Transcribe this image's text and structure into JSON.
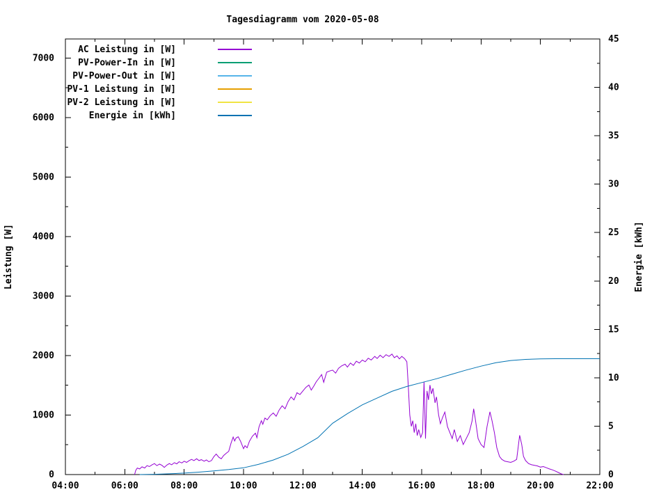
{
  "title": "Tagesdiagramm vom 2020-05-08",
  "axes": {
    "x": {
      "range_hours": [
        4,
        22
      ],
      "major_ticks": [
        {
          "v": 4,
          "label": "04:00"
        },
        {
          "v": 6,
          "label": "06:00"
        },
        {
          "v": 8,
          "label": "08:00"
        },
        {
          "v": 10,
          "label": "10:00"
        },
        {
          "v": 12,
          "label": "12:00"
        },
        {
          "v": 14,
          "label": "14:00"
        },
        {
          "v": 16,
          "label": "16:00"
        },
        {
          "v": 18,
          "label": "18:00"
        },
        {
          "v": 20,
          "label": "20:00"
        },
        {
          "v": 22,
          "label": "22:00"
        }
      ],
      "minor_step_hours": 1
    },
    "y_left": {
      "label": "Leistung [W]",
      "range": [
        0,
        7320
      ],
      "major_ticks": [
        0,
        1000,
        2000,
        3000,
        4000,
        5000,
        6000,
        7000
      ],
      "minor_step": 500
    },
    "y_right": {
      "label": "Energie [kWh]",
      "range": [
        0,
        45
      ],
      "major_ticks": [
        0,
        5,
        10,
        15,
        20,
        25,
        30,
        35,
        40,
        45
      ],
      "minor_step": 2.5
    }
  },
  "chart_data": {
    "type": "line",
    "title": "Tagesdiagramm vom 2020-05-08",
    "xlabel": "",
    "x_unit": "hour_of_day",
    "ylabel_left": "Leistung [W]",
    "ylabel_right": "Energie [kWh]",
    "ylim_left": [
      0,
      7320
    ],
    "ylim_right": [
      0,
      45
    ],
    "xlim_hours": [
      4,
      22
    ],
    "grid": false,
    "legend_position": "top-left-inside",
    "series": [
      {
        "name": "AC Leistung in [W]",
        "color": "#9400d3",
        "axis": "left",
        "points": [
          [
            6.33,
            0
          ],
          [
            6.37,
            70
          ],
          [
            6.42,
            110
          ],
          [
            6.5,
            95
          ],
          [
            6.58,
            130
          ],
          [
            6.67,
            110
          ],
          [
            6.75,
            150
          ],
          [
            6.83,
            135
          ],
          [
            6.92,
            165
          ],
          [
            7.0,
            185
          ],
          [
            7.08,
            150
          ],
          [
            7.17,
            175
          ],
          [
            7.25,
            155
          ],
          [
            7.33,
            120
          ],
          [
            7.42,
            160
          ],
          [
            7.5,
            185
          ],
          [
            7.58,
            165
          ],
          [
            7.67,
            200
          ],
          [
            7.75,
            180
          ],
          [
            7.83,
            215
          ],
          [
            7.92,
            195
          ],
          [
            8.0,
            225
          ],
          [
            8.08,
            205
          ],
          [
            8.17,
            235
          ],
          [
            8.25,
            255
          ],
          [
            8.33,
            235
          ],
          [
            8.42,
            265
          ],
          [
            8.5,
            235
          ],
          [
            8.58,
            250
          ],
          [
            8.67,
            225
          ],
          [
            8.75,
            245
          ],
          [
            8.83,
            215
          ],
          [
            8.92,
            235
          ],
          [
            9.0,
            300
          ],
          [
            9.08,
            345
          ],
          [
            9.17,
            290
          ],
          [
            9.25,
            265
          ],
          [
            9.33,
            320
          ],
          [
            9.42,
            360
          ],
          [
            9.5,
            390
          ],
          [
            9.58,
            530
          ],
          [
            9.65,
            630
          ],
          [
            9.7,
            565
          ],
          [
            9.75,
            615
          ],
          [
            9.82,
            635
          ],
          [
            9.9,
            560
          ],
          [
            10.0,
            435
          ],
          [
            10.05,
            485
          ],
          [
            10.12,
            450
          ],
          [
            10.2,
            560
          ],
          [
            10.3,
            645
          ],
          [
            10.4,
            695
          ],
          [
            10.45,
            620
          ],
          [
            10.52,
            800
          ],
          [
            10.6,
            905
          ],
          [
            10.65,
            845
          ],
          [
            10.72,
            950
          ],
          [
            10.8,
            920
          ],
          [
            10.9,
            990
          ],
          [
            11.0,
            1035
          ],
          [
            11.1,
            980
          ],
          [
            11.2,
            1085
          ],
          [
            11.3,
            1155
          ],
          [
            11.4,
            1105
          ],
          [
            11.5,
            1225
          ],
          [
            11.6,
            1305
          ],
          [
            11.7,
            1255
          ],
          [
            11.8,
            1375
          ],
          [
            11.9,
            1345
          ],
          [
            12.0,
            1405
          ],
          [
            12.1,
            1465
          ],
          [
            12.2,
            1505
          ],
          [
            12.28,
            1420
          ],
          [
            12.37,
            1490
          ],
          [
            12.45,
            1560
          ],
          [
            12.55,
            1625
          ],
          [
            12.63,
            1680
          ],
          [
            12.7,
            1550
          ],
          [
            12.8,
            1720
          ],
          [
            12.9,
            1740
          ],
          [
            13.0,
            1755
          ],
          [
            13.1,
            1705
          ],
          [
            13.2,
            1785
          ],
          [
            13.3,
            1825
          ],
          [
            13.42,
            1855
          ],
          [
            13.5,
            1805
          ],
          [
            13.6,
            1875
          ],
          [
            13.7,
            1835
          ],
          [
            13.8,
            1905
          ],
          [
            13.9,
            1875
          ],
          [
            14.0,
            1925
          ],
          [
            14.1,
            1895
          ],
          [
            14.2,
            1955
          ],
          [
            14.3,
            1925
          ],
          [
            14.42,
            1985
          ],
          [
            14.5,
            1950
          ],
          [
            14.6,
            2005
          ],
          [
            14.7,
            1965
          ],
          [
            14.8,
            2015
          ],
          [
            14.9,
            1985
          ],
          [
            15.0,
            2025
          ],
          [
            15.08,
            1965
          ],
          [
            15.17,
            1995
          ],
          [
            15.25,
            1945
          ],
          [
            15.33,
            1985
          ],
          [
            15.42,
            1950
          ],
          [
            15.5,
            1895
          ],
          [
            15.55,
            1480
          ],
          [
            15.6,
            1000
          ],
          [
            15.65,
            810
          ],
          [
            15.7,
            905
          ],
          [
            15.75,
            705
          ],
          [
            15.8,
            855
          ],
          [
            15.85,
            655
          ],
          [
            15.9,
            755
          ],
          [
            15.97,
            625
          ],
          [
            16.03,
            705
          ],
          [
            16.08,
            1560
          ],
          [
            16.13,
            605
          ],
          [
            16.18,
            1405
          ],
          [
            16.23,
            1255
          ],
          [
            16.28,
            1505
          ],
          [
            16.33,
            1355
          ],
          [
            16.38,
            1450
          ],
          [
            16.45,
            1205
          ],
          [
            16.5,
            1305
          ],
          [
            16.57,
            1005
          ],
          [
            16.63,
            855
          ],
          [
            16.7,
            955
          ],
          [
            16.78,
            1050
          ],
          [
            16.87,
            805
          ],
          [
            16.95,
            705
          ],
          [
            17.03,
            605
          ],
          [
            17.1,
            755
          ],
          [
            17.2,
            555
          ],
          [
            17.3,
            655
          ],
          [
            17.4,
            505
          ],
          [
            17.5,
            605
          ],
          [
            17.6,
            705
          ],
          [
            17.7,
            905
          ],
          [
            17.75,
            1105
          ],
          [
            17.8,
            955
          ],
          [
            17.9,
            605
          ],
          [
            18.0,
            505
          ],
          [
            18.1,
            455
          ],
          [
            18.2,
            805
          ],
          [
            18.3,
            1055
          ],
          [
            18.37,
            905
          ],
          [
            18.45,
            705
          ],
          [
            18.53,
            455
          ],
          [
            18.62,
            305
          ],
          [
            18.7,
            255
          ],
          [
            18.8,
            225
          ],
          [
            18.9,
            215
          ],
          [
            19.0,
            205
          ],
          [
            19.1,
            225
          ],
          [
            19.2,
            255
          ],
          [
            19.3,
            660
          ],
          [
            19.37,
            505
          ],
          [
            19.43,
            305
          ],
          [
            19.5,
            235
          ],
          [
            19.6,
            185
          ],
          [
            19.7,
            165
          ],
          [
            19.8,
            155
          ],
          [
            19.9,
            145
          ],
          [
            20.0,
            125
          ],
          [
            20.1,
            135
          ],
          [
            20.2,
            115
          ],
          [
            20.3,
            95
          ],
          [
            20.4,
            80
          ],
          [
            20.5,
            60
          ],
          [
            20.6,
            35
          ],
          [
            20.7,
            12
          ],
          [
            20.78,
            0
          ]
        ]
      },
      {
        "name": "PV-Power-In in [W]",
        "color": "#009e73",
        "axis": "left",
        "points": []
      },
      {
        "name": "PV-Power-Out in [W]",
        "color": "#56b4e9",
        "axis": "left",
        "points": []
      },
      {
        "name": "PV-1 Leistung in [W]",
        "color": "#e69f00",
        "axis": "left",
        "points": []
      },
      {
        "name": "PV-2 Leistung in [W]",
        "color": "#f0e442",
        "axis": "left",
        "points": []
      },
      {
        "name": "Energie in [kWh]",
        "color": "#0072b2",
        "axis": "right",
        "points": [
          [
            6.5,
            0
          ],
          [
            7.0,
            0.03
          ],
          [
            7.5,
            0.08
          ],
          [
            8.0,
            0.15
          ],
          [
            8.5,
            0.25
          ],
          [
            9.0,
            0.38
          ],
          [
            9.5,
            0.52
          ],
          [
            10.0,
            0.7
          ],
          [
            10.5,
            1.05
          ],
          [
            11.0,
            1.5
          ],
          [
            11.5,
            2.1
          ],
          [
            12.0,
            2.9
          ],
          [
            12.5,
            3.8
          ],
          [
            13.0,
            5.3
          ],
          [
            13.5,
            6.3
          ],
          [
            14.0,
            7.2
          ],
          [
            14.5,
            7.9
          ],
          [
            15.0,
            8.6
          ],
          [
            15.5,
            9.1
          ],
          [
            16.0,
            9.5
          ],
          [
            16.5,
            9.9
          ],
          [
            17.0,
            10.35
          ],
          [
            17.5,
            10.8
          ],
          [
            18.0,
            11.2
          ],
          [
            18.5,
            11.55
          ],
          [
            19.0,
            11.78
          ],
          [
            19.5,
            11.9
          ],
          [
            20.0,
            11.95
          ],
          [
            20.5,
            11.97
          ],
          [
            21.0,
            11.97
          ],
          [
            21.5,
            11.97
          ],
          [
            22.0,
            11.97
          ]
        ]
      }
    ]
  }
}
